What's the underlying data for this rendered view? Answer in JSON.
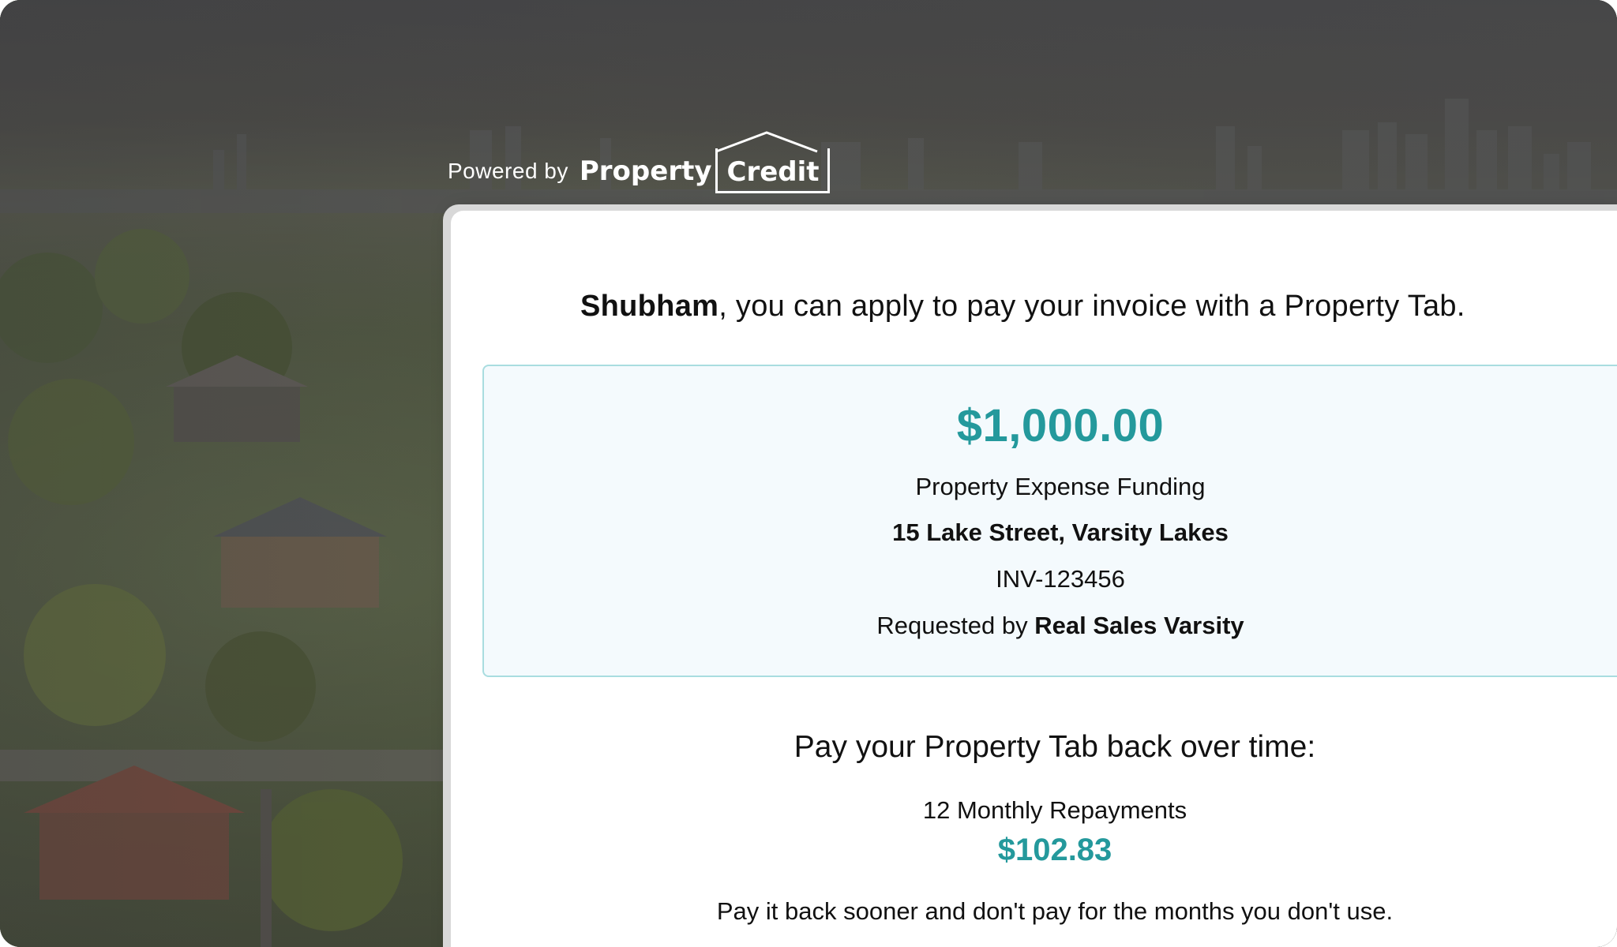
{
  "header": {
    "powered_by": "Powered by",
    "brand_left": "Property",
    "brand_right": "Credit"
  },
  "intro": {
    "name": "Shubham",
    "message": ", you can apply to pay your invoice with a Property Tab."
  },
  "invoice": {
    "amount": "$1,000.00",
    "type": "Property Expense Funding",
    "address": "15 Lake Street, Varsity Lakes",
    "number": "INV-123456",
    "requested_by_label": "Requested by ",
    "requested_by": "Real Sales Varsity"
  },
  "repayment": {
    "title": "Pay your Property Tab back over time:",
    "count": "12 Monthly Repayments",
    "amount": "$102.83",
    "note": "Pay it back sooner and don't pay for the months you don't use."
  },
  "colors": {
    "accent": "#24999c",
    "box_bg": "#f4fafd",
    "box_border": "#a9dde0"
  }
}
